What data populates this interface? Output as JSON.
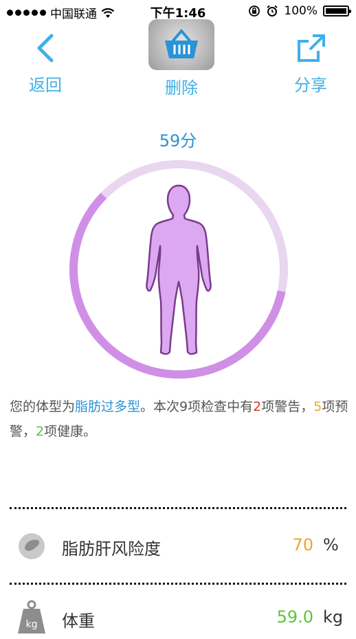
{
  "status_bar": {
    "carrier": "中国联通",
    "time": "下午1:46",
    "battery": "100%"
  },
  "nav": {
    "back_label": "返回",
    "delete_label": "删除",
    "share_label": "分享"
  },
  "score": {
    "text": "59分",
    "value": 59,
    "max": 100
  },
  "colors": {
    "accent_blue": "#2a93d5",
    "ring_active": "#d08fe6",
    "ring_track": "#e9d6ef",
    "body_fill": "#dba8f1",
    "body_stroke": "#7a3a8a",
    "warning_red": "#e0322a",
    "alert_orange": "#f0a52a",
    "healthy_green": "#5cc53a"
  },
  "summary": {
    "prefix": "您的体型为",
    "body_type": "脂肪过多型",
    "middle": "。本次9项检查中有",
    "warning_count": "2",
    "warning_text": "项警告，",
    "alert_count": "5",
    "alert_text": "项预警，",
    "healthy_count": "2",
    "healthy_text": "项健康。"
  },
  "metrics": [
    {
      "name": "脂肪肝风险度",
      "value": "70",
      "unit": "%",
      "value_color": "#f0a52a",
      "icon": "liver-icon"
    },
    {
      "name": "体重",
      "value": "59.0",
      "unit": "kg",
      "value_color": "#5cc53a",
      "icon": "weight-icon",
      "icon_text": "kg"
    }
  ]
}
